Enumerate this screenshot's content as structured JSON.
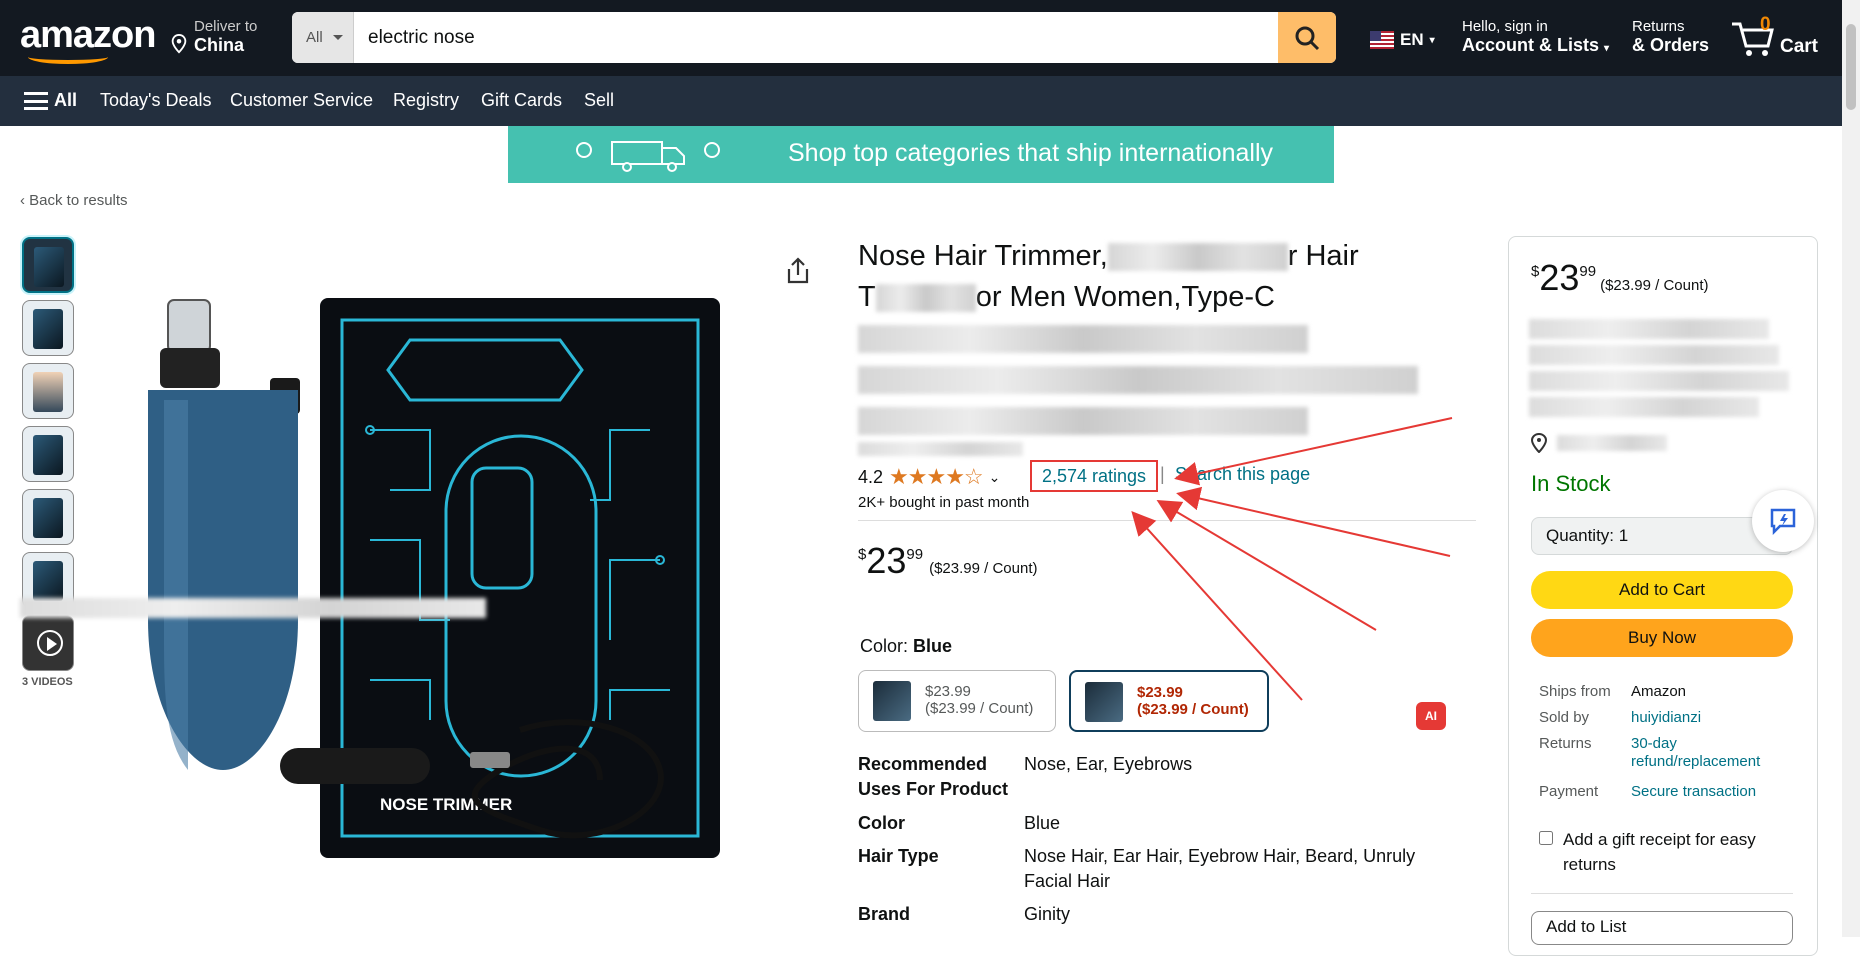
{
  "header": {
    "logo_text": "amazon",
    "deliver_line1": "Deliver to",
    "deliver_line2": "China",
    "search_category": "All",
    "search_value": "electric nose",
    "language": "EN",
    "account_line1": "Hello, sign in",
    "account_line2": "Account & Lists",
    "orders_line1": "Returns",
    "orders_line2": "& Orders",
    "cart_count": "0",
    "cart_label": "Cart"
  },
  "nav": {
    "all": "All",
    "items": [
      "Today's Deals",
      "Customer Service",
      "Registry",
      "Gift Cards",
      "Sell"
    ]
  },
  "banner": {
    "text": "Shop top categories that ship internationally"
  },
  "breadcrumb": {
    "back": "‹ Back to results"
  },
  "gallery": {
    "videos_label": "3 VIDEOS"
  },
  "product": {
    "title_part1": "Nose Hair Trimmer,",
    "title_part2": "r Hair",
    "title_part3": "T",
    "title_part4": "or Men Women,Type-C",
    "rating": "4.2",
    "stars": "★★★★☆",
    "ratings_count": "2,574 ratings",
    "separator": "|",
    "search_page": "Search this page",
    "bought": "2K+ bought in past month",
    "price_symbol": "$",
    "price_whole": "23",
    "price_fraction": "99",
    "price_per": "($23.99 / Count)",
    "color_label": "Color:",
    "color_value": "Blue",
    "swatches": [
      {
        "price": "$23.99",
        "per": "($23.99 / Count)"
      },
      {
        "price": "$23.99",
        "per": "($23.99 / Count)"
      }
    ],
    "ai_badge": "AI",
    "specs": [
      {
        "k": "Recommended Uses For Product",
        "v": "Nose, Ear, Eyebrows"
      },
      {
        "k": "Color",
        "v": "Blue"
      },
      {
        "k": "Hair Type",
        "v": "Nose Hair, Ear Hair, Eyebrow Hair, Beard, Unruly Facial Hair"
      },
      {
        "k": "Brand",
        "v": "Ginity"
      }
    ],
    "image_label": "NOSE TRIMMER"
  },
  "buybox": {
    "price_symbol": "$",
    "price_whole": "23",
    "price_fraction": "99",
    "price_per": "($23.99 / Count)",
    "in_stock": "In Stock",
    "quantity": "Quantity:  1",
    "add_to_cart": "Add to Cart",
    "buy_now": "Buy Now",
    "ships_from_k": "Ships from",
    "ships_from_v": "Amazon",
    "sold_by_k": "Sold by",
    "sold_by_v": "huiyidianzi",
    "returns_k": "Returns",
    "returns_v": "30-day refund/replacement",
    "payment_k": "Payment",
    "payment_v": "Secure transaction",
    "gift": "Add a gift receipt for easy returns",
    "add_to_list": "Add to List"
  },
  "colors": {
    "accent": "#ff9900",
    "link": "#007185",
    "annotation": "#e53935"
  }
}
